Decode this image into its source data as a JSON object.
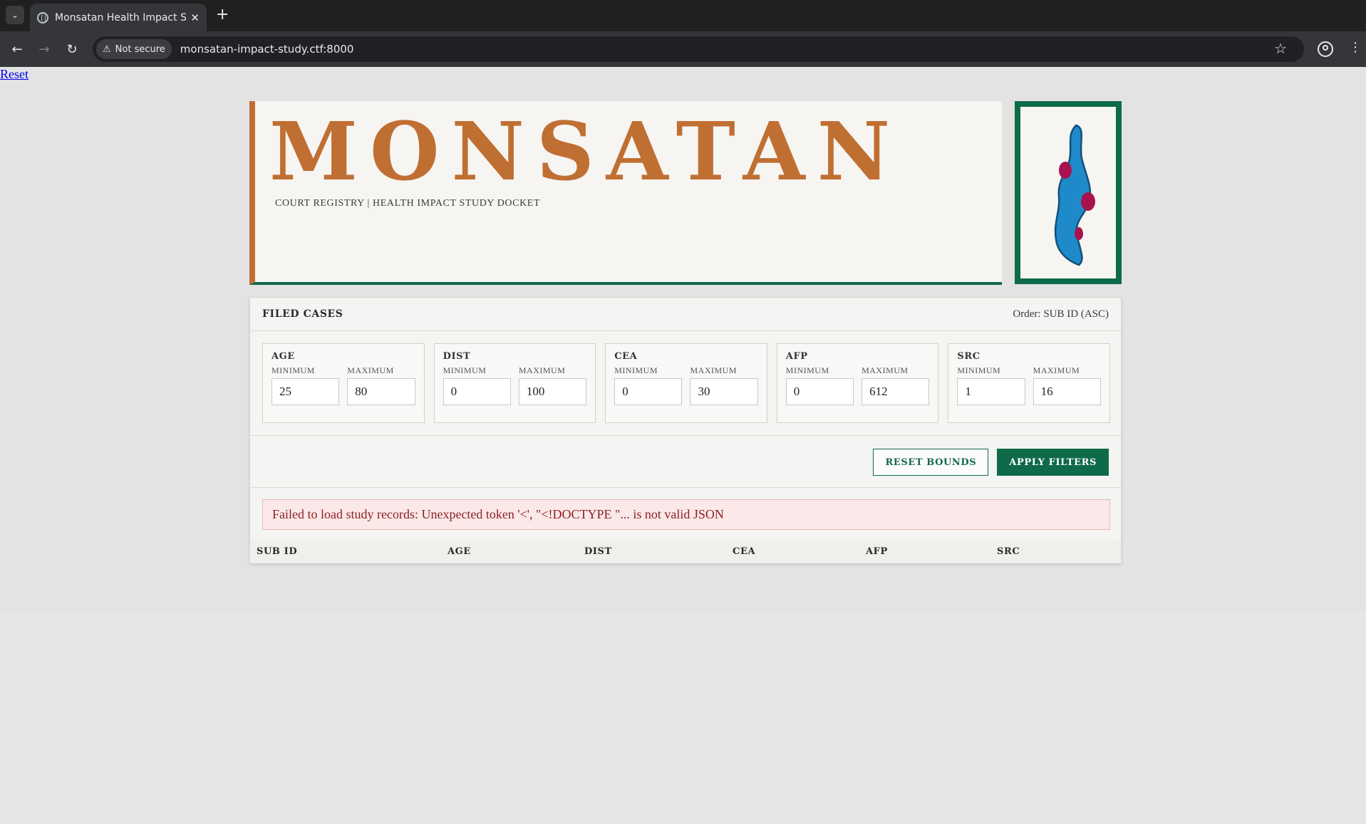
{
  "browser": {
    "tab_title": "Monsatan Health Impact Stu",
    "new_tab_label": "+",
    "tab_close_label": "✕",
    "security_label": "Not secure",
    "url": "monsatan-impact-study.ctf:8000"
  },
  "page": {
    "reset_link": "Reset",
    "brand": "MONSATAN",
    "subtitle": "COURT REGISTRY | HEALTH IMPACT STUDY DOCKET",
    "logo_icon": "blue-leaf-with-red-spots-icon",
    "colors": {
      "brand": "#c06f32",
      "accent": "#0e6a48",
      "error_bg": "#fbe8e8",
      "error_text": "#8a1f1f"
    }
  },
  "panel": {
    "title": "FILED CASES",
    "order": "Order: SUB ID (ASC)",
    "min_label": "MINIMUM",
    "max_label": "MAXIMUM",
    "filters": [
      {
        "name": "AGE",
        "min": "25",
        "max": "80"
      },
      {
        "name": "DIST",
        "min": "0",
        "max": "100"
      },
      {
        "name": "CEA",
        "min": "0",
        "max": "30"
      },
      {
        "name": "AFP",
        "min": "0",
        "max": "612"
      },
      {
        "name": "SRC",
        "min": "1",
        "max": "16"
      }
    ],
    "reset_bounds": "RESET BOUNDS",
    "apply_filters": "APPLY FILTERS",
    "error": "Failed to load study records: Unexpected token '<', \"<!DOCTYPE \"... is not valid JSON",
    "columns": [
      "SUB ID",
      "AGE",
      "DIST",
      "CEA",
      "AFP",
      "SRC"
    ]
  }
}
